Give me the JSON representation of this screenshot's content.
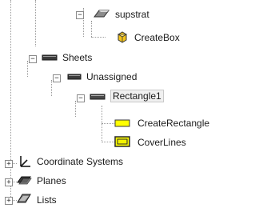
{
  "tree": {
    "supstrat": {
      "label": "supstrat",
      "expander": "−",
      "icon": "wedge-solid-icon",
      "children": {
        "create_box": {
          "label": "CreateBox",
          "icon": "create-box-icon"
        }
      }
    },
    "sheets": {
      "label": "Sheets",
      "expander": "−",
      "icon": "sheet-folder-icon",
      "children": {
        "unassigned": {
          "label": "Unassigned",
          "expander": "−",
          "icon": "sheet-group-icon",
          "children": {
            "rectangle1": {
              "label": "Rectangle1",
              "expander": "−",
              "icon": "sheet-object-icon",
              "children": {
                "create_rectangle": {
                  "label": "CreateRectangle",
                  "icon": "yellow-rectangle-icon",
                  "color": "#ffff00"
                },
                "cover_lines": {
                  "label": "CoverLines",
                  "icon": "cover-lines-icon",
                  "color": "#ffff00"
                }
              }
            }
          }
        }
      }
    },
    "coordinate_systems": {
      "label": "Coordinate Systems",
      "expander": "+",
      "icon": "axes-icon"
    },
    "planes": {
      "label": "Planes",
      "expander": "+",
      "icon": "planes-icon"
    },
    "lists": {
      "label": "Lists",
      "expander": "+",
      "icon": "lists-icon"
    }
  }
}
